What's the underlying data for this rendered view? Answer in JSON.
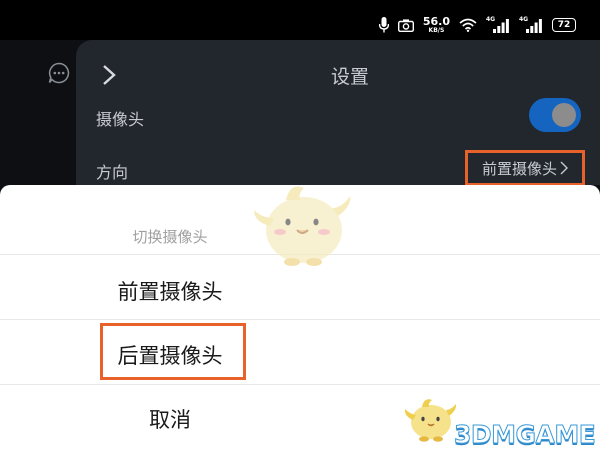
{
  "status_bar": {
    "speed_value": "56.0",
    "speed_unit": "KB/S",
    "net1_label": "4G",
    "net2_label": "4G",
    "battery": "72"
  },
  "panel": {
    "title": "设置",
    "camera_label": "摄像头",
    "camera_toggle_on": true,
    "direction_label": "方向",
    "direction_value": "前置摄像头"
  },
  "sheet": {
    "title": "切换摄像头",
    "options": [
      "前置摄像头",
      "后置摄像头"
    ],
    "cancel": "取消"
  },
  "watermark": {
    "text": "3DMGAME"
  },
  "colors": {
    "highlight": "#e8612a",
    "toggle": "#1565c0"
  }
}
